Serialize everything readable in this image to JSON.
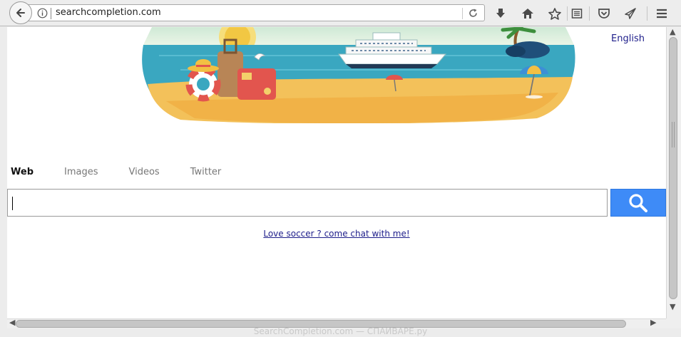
{
  "browser": {
    "url": "searchcompletion.com",
    "icons": [
      "back-arrow-icon",
      "info-icon",
      "reload-icon",
      "download-icon",
      "home-icon",
      "star-icon",
      "reading-list-icon",
      "pocket-icon",
      "send-icon",
      "menu-icon"
    ]
  },
  "page": {
    "language_link": "English",
    "tabs": [
      {
        "label": "Web",
        "active": true
      },
      {
        "label": "Images",
        "active": false
      },
      {
        "label": "Videos",
        "active": false
      },
      {
        "label": "Twitter",
        "active": false
      }
    ],
    "search": {
      "value": "",
      "placeholder": ""
    },
    "promo_link": "Love soccer ? come chat with me!"
  },
  "footer": {
    "watermark": "SearchCompletion.com — СПАЙВАРЕ.ру"
  },
  "colors": {
    "search_button": "#3e8bf7",
    "link": "#1d1d8a",
    "sea": "#3aa7c0",
    "sand": "#f3c15a"
  }
}
